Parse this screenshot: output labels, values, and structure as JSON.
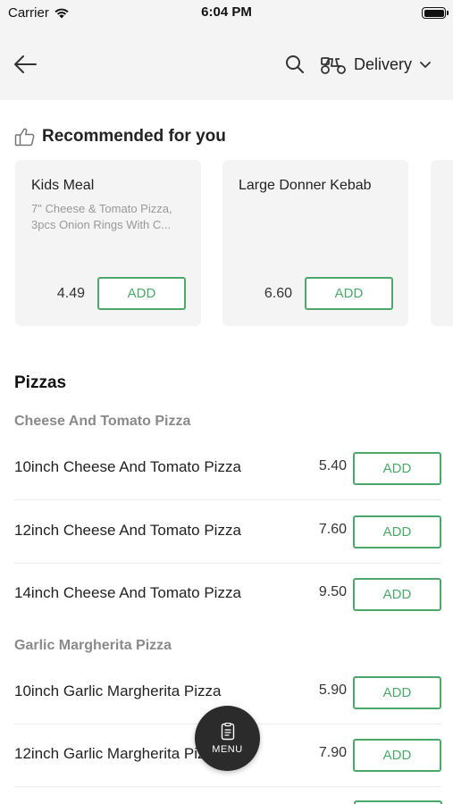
{
  "status_bar": {
    "carrier": "Carrier",
    "time": "6:04 PM"
  },
  "header": {
    "delivery_label": "Delivery"
  },
  "recommended": {
    "title": "Recommended for you",
    "items": [
      {
        "name": "Kids Meal",
        "description": "7\" Cheese & Tomato Pizza, 3pcs Onion Rings With C...",
        "price": "4.49",
        "add_label": "ADD"
      },
      {
        "name": "Large Donner Kebab",
        "description": "",
        "price": "6.60",
        "add_label": "ADD"
      }
    ]
  },
  "menu": {
    "section_title": "Pizzas",
    "groups": [
      {
        "title": "Cheese And Tomato Pizza",
        "items": [
          {
            "name": "10inch Cheese And Tomato Pizza",
            "price": "5.40",
            "add_label": "ADD"
          },
          {
            "name": "12inch Cheese And Tomato Pizza",
            "price": "7.60",
            "add_label": "ADD"
          },
          {
            "name": "14inch Cheese And Tomato Pizza",
            "price": "9.50",
            "add_label": "ADD"
          }
        ]
      },
      {
        "title": "Garlic Margherita Pizza",
        "items": [
          {
            "name": "10inch Garlic Margherita Pizza",
            "price": "5.90",
            "add_label": "ADD"
          },
          {
            "name": "12inch Garlic Margherita Pizza",
            "price": "7.90",
            "add_label": "ADD"
          }
        ]
      }
    ]
  },
  "fab": {
    "label": "MENU"
  },
  "colors": {
    "accent": "#4ca86a",
    "header_bg": "#f4f4f4",
    "fab_bg": "#2b2b2b"
  }
}
